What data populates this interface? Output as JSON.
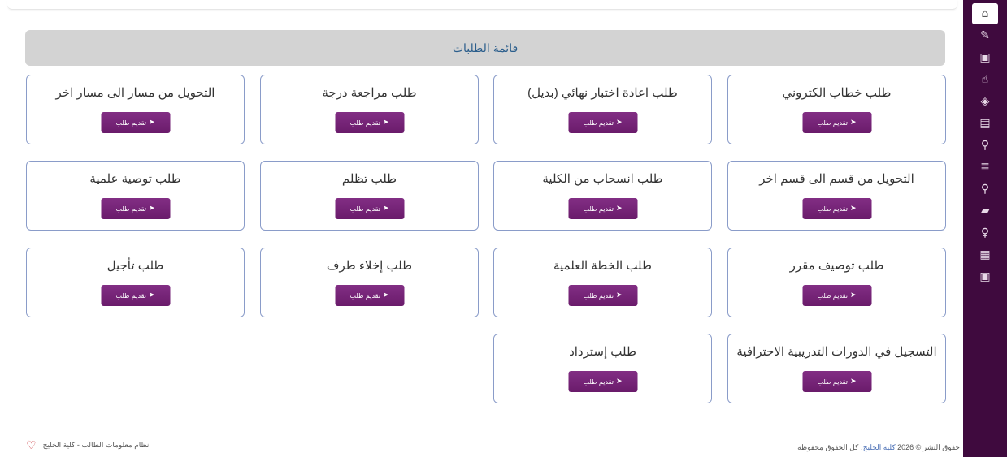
{
  "heading": "قائمة الطلبات",
  "submit_label": "تقديم طلب",
  "sidebar_icons": [
    "home-icon",
    "edit-icon",
    "grid-icon",
    "hand-icon",
    "layers-icon",
    "id-card-icon",
    "paperclip-icon",
    "list-icon",
    "bulb-icon",
    "book-icon",
    "bulb-icon-2",
    "calendar-icon",
    "grid-icon-2"
  ],
  "cards": [
    {
      "title": "طلب خطاب الكتروني"
    },
    {
      "title": "طلب اعادة اختبار نهائي (بديل)"
    },
    {
      "title": "طلب مراجعة درجة"
    },
    {
      "title": "التحويل من مسار الى مسار اخر"
    },
    {
      "title": "التحويل من قسم الى قسم اخر"
    },
    {
      "title": "طلب انسحاب من الكلية"
    },
    {
      "title": "طلب تظلم"
    },
    {
      "title": "طلب توصية علمية"
    },
    {
      "title": "طلب توصيف مقرر"
    },
    {
      "title": "طلب الخطة العلمية"
    },
    {
      "title": "طلب إخلاء طرف"
    },
    {
      "title": "طلب تأجيل"
    },
    {
      "title": "التسجيل في الدورات التدريبية الاحترافية"
    },
    {
      "title": "طلب إسترداد"
    }
  ],
  "footer": {
    "copyright_prefix": "حقوق النشر © 2026",
    "college_link": "كلية الخليج",
    "rights": "كل الحقوق محفوظة",
    "system_name": "نظام معلومات الطالب - كلية الخليج"
  }
}
